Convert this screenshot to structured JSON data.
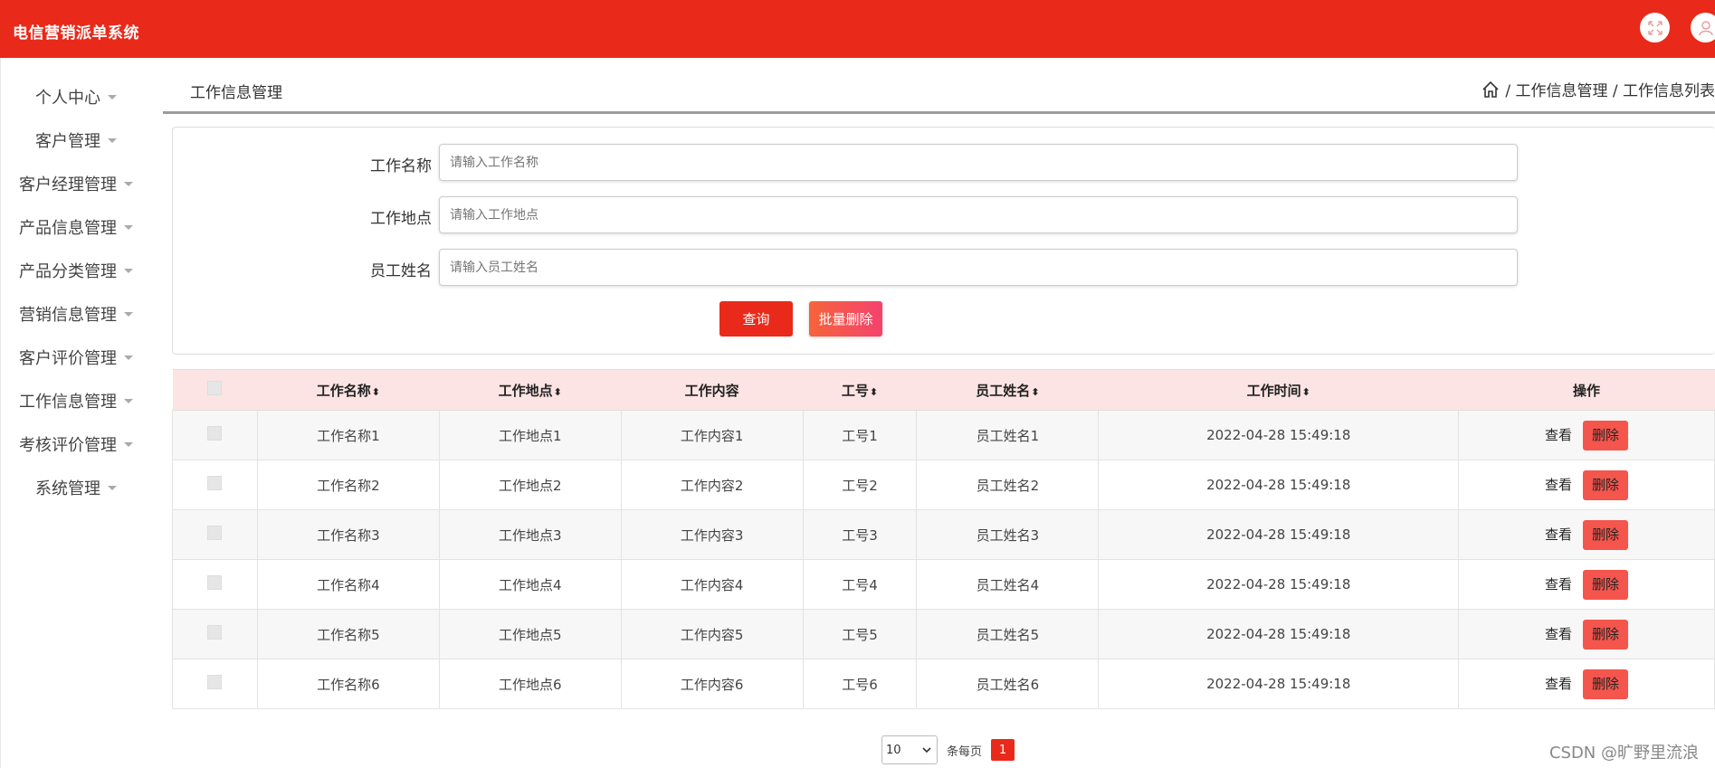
{
  "header": {
    "title": "电信营销派单系统"
  },
  "sidebar": {
    "items": [
      {
        "label": "个人中心"
      },
      {
        "label": "客户管理"
      },
      {
        "label": "客户经理管理"
      },
      {
        "label": "产品信息管理"
      },
      {
        "label": "产品分类管理"
      },
      {
        "label": "营销信息管理"
      },
      {
        "label": "客户评价管理"
      },
      {
        "label": "工作信息管理"
      },
      {
        "label": "考核评价管理"
      },
      {
        "label": "系统管理"
      }
    ]
  },
  "breadcrumb": {
    "page_title": "工作信息管理",
    "path": "/ 工作信息管理 / 工作信息列表"
  },
  "search": {
    "fields": [
      {
        "label": "工作名称",
        "placeholder": "请输入工作名称",
        "value": ""
      },
      {
        "label": "工作地点",
        "placeholder": "请输入工作地点",
        "value": ""
      },
      {
        "label": "员工姓名",
        "placeholder": "请输入员工姓名",
        "value": ""
      }
    ],
    "query_label": "查询",
    "batch_delete_label": "批量删除"
  },
  "table": {
    "columns": [
      "工作名称",
      "工作地点",
      "工作内容",
      "工号",
      "员工姓名",
      "工作时间",
      "操作"
    ],
    "sortable": [
      true,
      true,
      false,
      true,
      true,
      true,
      false
    ],
    "rows": [
      {
        "name": "工作名称1",
        "place": "工作地点1",
        "content": "工作内容1",
        "no": "工号1",
        "staff": "员工姓名1",
        "time": "2022-04-28 15:49:18"
      },
      {
        "name": "工作名称2",
        "place": "工作地点2",
        "content": "工作内容2",
        "no": "工号2",
        "staff": "员工姓名2",
        "time": "2022-04-28 15:49:18"
      },
      {
        "name": "工作名称3",
        "place": "工作地点3",
        "content": "工作内容3",
        "no": "工号3",
        "staff": "员工姓名3",
        "time": "2022-04-28 15:49:18"
      },
      {
        "name": "工作名称4",
        "place": "工作地点4",
        "content": "工作内容4",
        "no": "工号4",
        "staff": "员工姓名4",
        "time": "2022-04-28 15:49:18"
      },
      {
        "name": "工作名称5",
        "place": "工作地点5",
        "content": "工作内容5",
        "no": "工号5",
        "staff": "员工姓名5",
        "time": "2022-04-28 15:49:18"
      },
      {
        "name": "工作名称6",
        "place": "工作地点6",
        "content": "工作内容6",
        "no": "工号6",
        "staff": "员工姓名6",
        "time": "2022-04-28 15:49:18"
      }
    ],
    "view_label": "查看",
    "delete_label": "删除"
  },
  "pagination": {
    "page_size": "10",
    "page_size_label": "条每页",
    "current_page": "1"
  },
  "watermark": "CSDN @旷野里流浪",
  "colors": {
    "primary": "#e92a1a",
    "header_row": "#fbe4e3",
    "delete_button": "#f4554d"
  }
}
